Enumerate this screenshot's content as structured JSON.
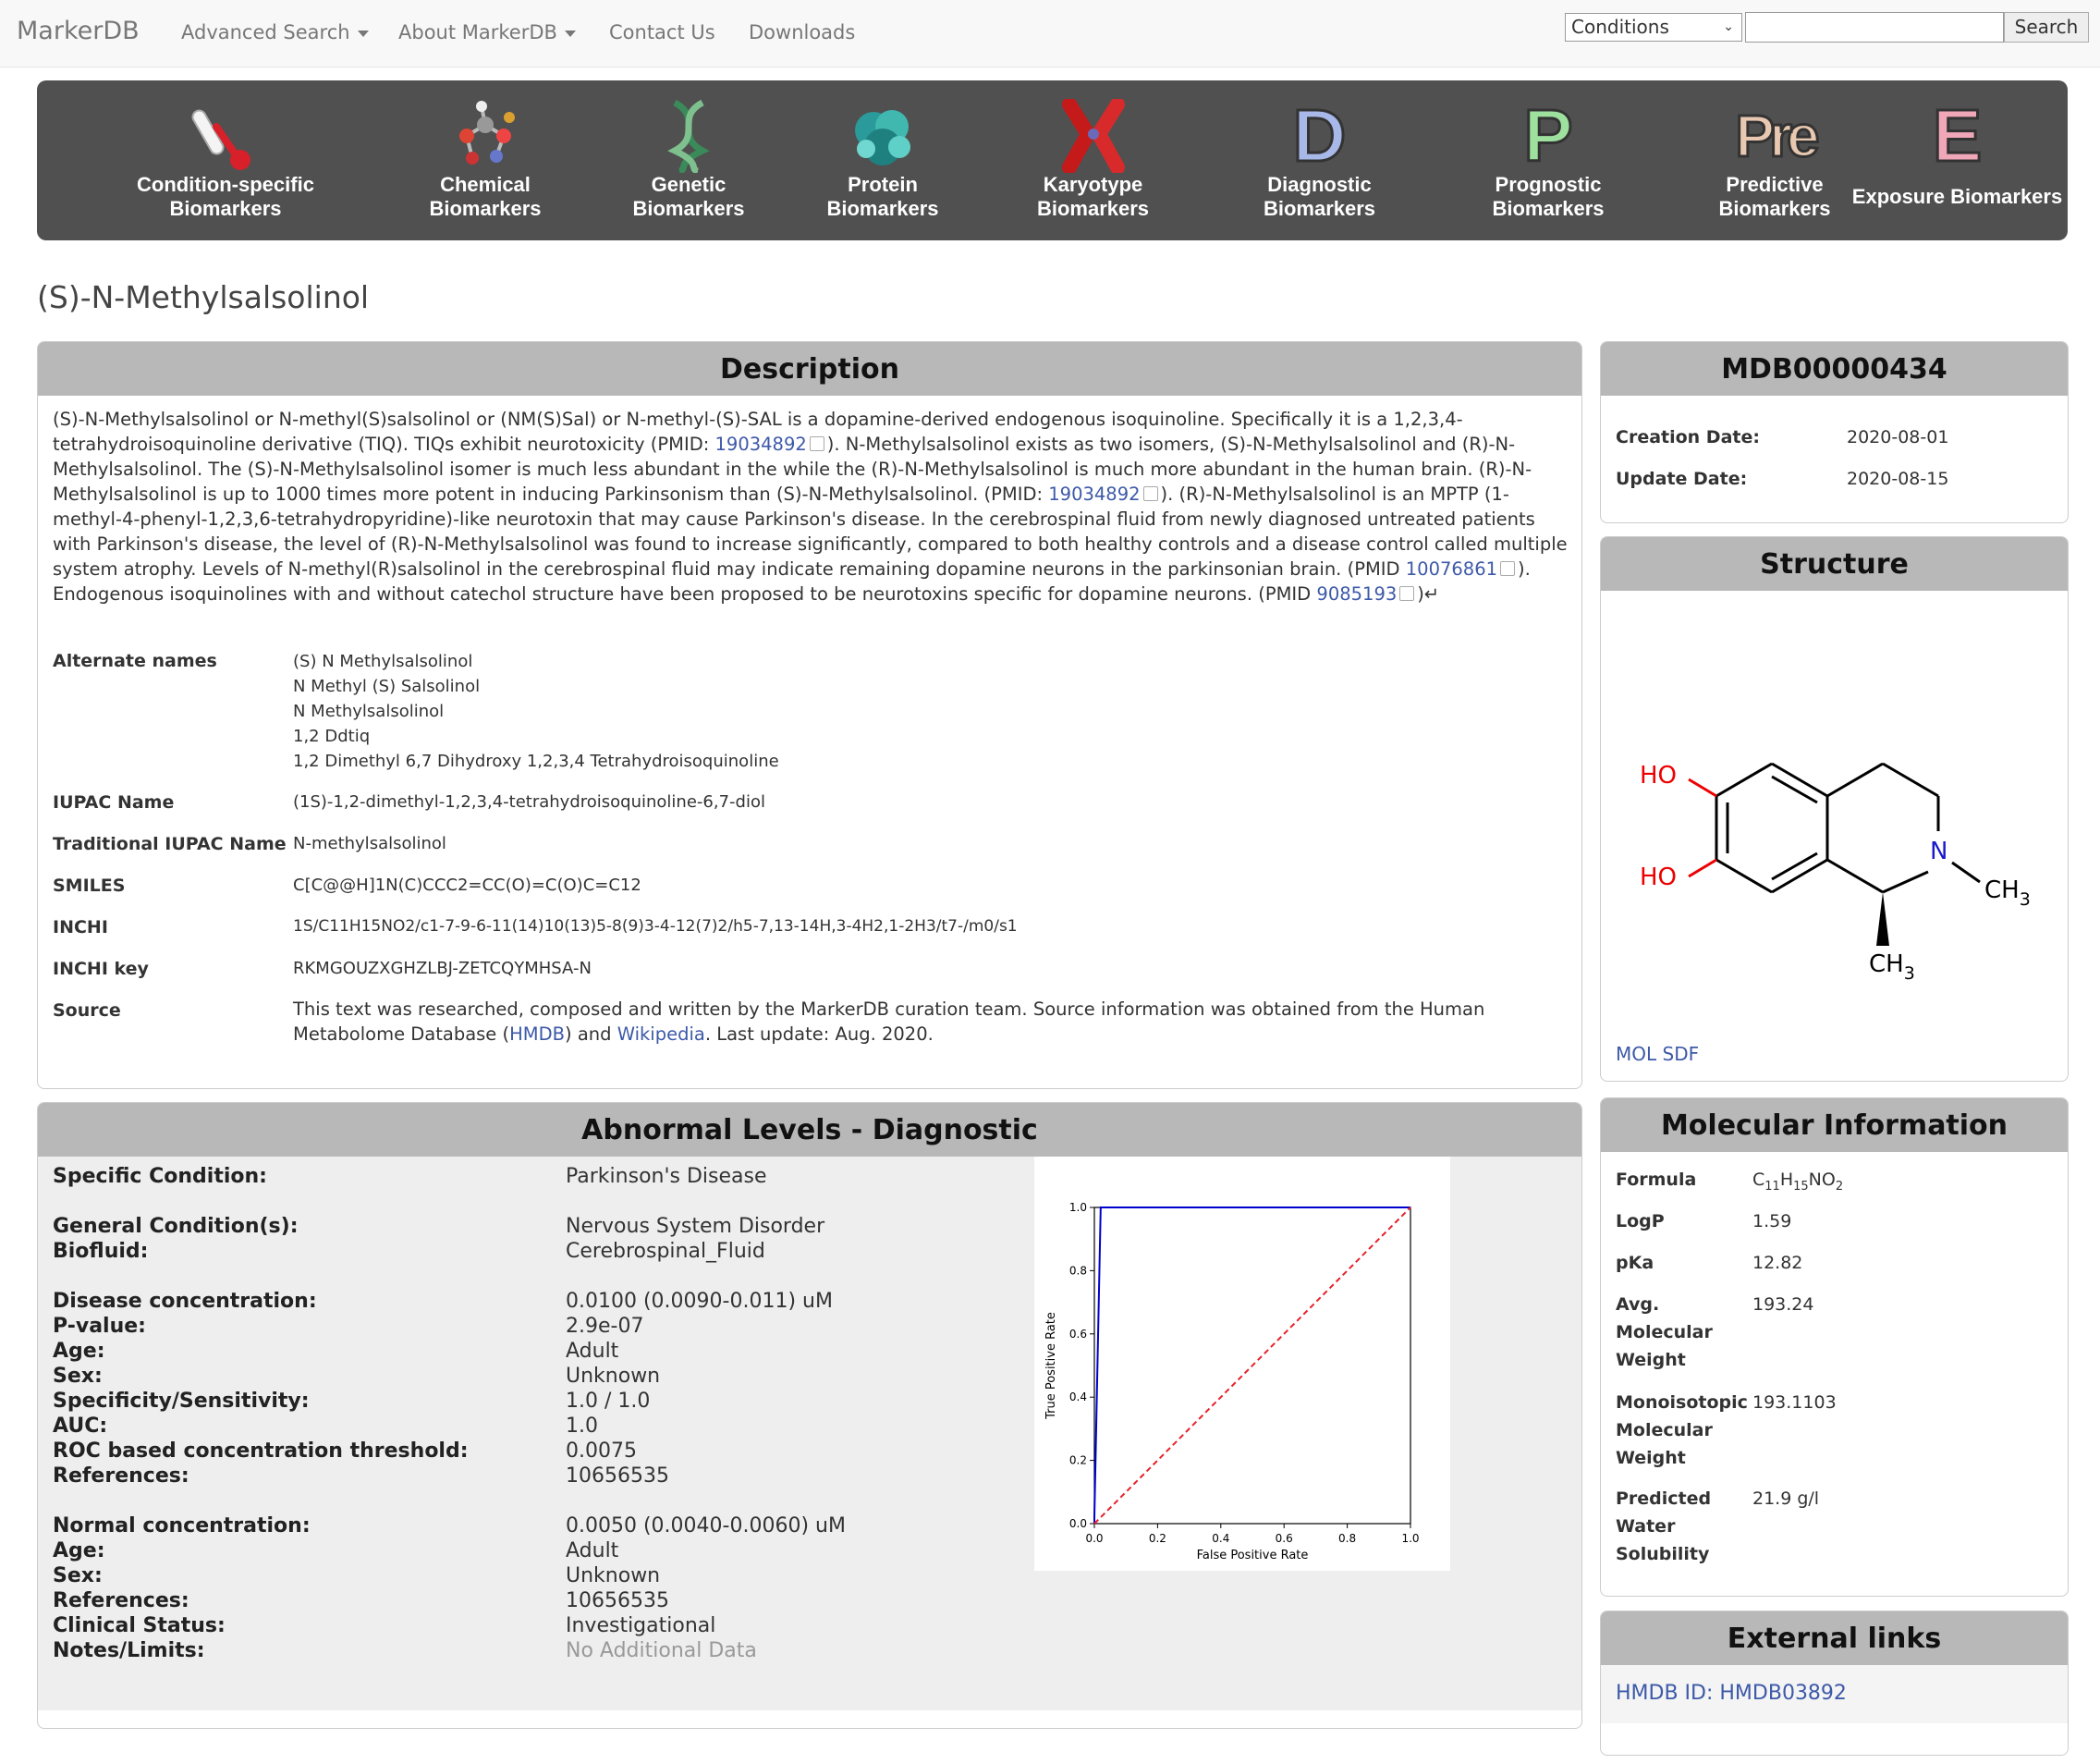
{
  "navbar": {
    "brand": "MarkerDB",
    "items": [
      "Advanced Search",
      "About MarkerDB",
      "Contact Us",
      "Downloads"
    ],
    "select_value": "Conditions",
    "search_button": "Search"
  },
  "categories": [
    {
      "line1": "Condition-specific",
      "line2": "Biomarkers",
      "icon": "thermometer-icon"
    },
    {
      "line1": "Chemical",
      "line2": "Biomarkers",
      "icon": "molecule-icon"
    },
    {
      "line1": "Genetic",
      "line2": "Biomarkers",
      "icon": "dna-icon"
    },
    {
      "line1": "Protein",
      "line2": "Biomarkers",
      "icon": "protein-icon"
    },
    {
      "line1": "Karyotype",
      "line2": "Biomarkers",
      "icon": "chromosome-icon"
    },
    {
      "line1": "Diagnostic",
      "line2": "Biomarkers",
      "icon": "letter-d-icon",
      "letter": "D"
    },
    {
      "line1": "Prognostic",
      "line2": "Biomarkers",
      "icon": "letter-p-icon",
      "letter": "P"
    },
    {
      "line1": "Predictive",
      "line2": "Biomarkers",
      "icon": "letter-pre-icon",
      "letter": "Pre"
    },
    {
      "line1": "Exposure Biomarkers",
      "line2": "",
      "icon": "letter-e-icon",
      "letter": "E"
    }
  ],
  "page_title": "(S)-N-Methylsalsolinol",
  "description": {
    "heading": "Description",
    "p1": "(S)-N-Methylsalsolinol or N-methyl(S)salsolinol or (NM(S)Sal) or N-methyl-(S)-SAL is a dopamine-derived endogenous isoquinoline. Specifically it is a 1,2,3,4-tetrahydroisoquinoline derivative (TIQ). TIQs exhibit neurotoxicity (PMID: ",
    "pmid1": "19034892",
    "p2": "). N-Methylsalsolinol exists as two isomers, (S)-N-Methylsalsolinol and (R)-N-Methylsalsolinol. The (S)-N-Methylsalsolinol isomer is much less abundant in the while the (R)-N-Methylsalsolinol is much more abundant in the human brain. (R)-N-Methylsalsolinol is up to 1000 times more potent in inducing Parkinsonism than (S)-N-Methylsalsolinol. (PMID: ",
    "pmid2": "19034892",
    "p3": "). (R)-N-Methylsalsolinol is an MPTP (1-methyl-4-phenyl-1,2,3,6-tetrahydropyridine)-like neurotoxin that may cause Parkinson's disease. In the cerebrospinal fluid from newly diagnosed untreated patients with Parkinson's disease, the level of (R)-N-Methylsalsolinol was found to increase significantly, compared to both healthy controls and a disease control called multiple system atrophy. Levels of N-methyl(R)salsolinol in the cerebrospinal fluid may indicate remaining dopamine neurons in the parkinsonian brain. (PMID ",
    "pmid3": "10076861",
    "p4": "). Endogenous isoquinolines with and without catechol structure have been proposed to be neurotoxins specific for dopamine neurons. (PMID ",
    "pmid4": "9085193",
    "p5": ")↵",
    "alt_label": "Alternate names",
    "alt_names": [
      "(S) N Methylsalsolinol",
      "N Methyl (S) Salsolinol",
      "N Methylsalsolinol",
      "1,2 Ddtiq",
      "1,2 Dimethyl 6,7 Dihydroxy 1,2,3,4 Tetrahydroisoquinoline"
    ],
    "iupac_label": "IUPAC Name",
    "iupac": "(1S)-1,2-dimethyl-1,2,3,4-tetrahydroisoquinoline-6,7-diol",
    "trad_label": "Traditional IUPAC Name",
    "trad": "N-methylsalsolinol",
    "smiles_label": "SMILES",
    "smiles": "C[C@@H]1N(C)CCC2=CC(O)=C(O)C=C12",
    "inchi_label": "INCHI",
    "inchi": "1S/C11H15NO2/c1-7-9-6-11(14)10(13)5-8(9)3-4-12(7)2/h5-7,13-14H,3-4H2,1-2H3/t7-/m0/s1",
    "inchikey_label": "INCHI key",
    "inchikey": "RKMGOUZXGHZLBJ-ZETCQYMHSA-N",
    "source_label": "Source",
    "source_a": "This text was researched, composed and written by the MarkerDB curation team. Source information was obtained from the Human Metabolome Database (",
    "source_hmdb": "HMDB",
    "source_b": ") and ",
    "source_wiki": "Wikipedia",
    "source_c": ". Last update: Aug. 2020."
  },
  "meta": {
    "id": "MDB00000434",
    "creation_label": "Creation Date:",
    "creation": "2020-08-01",
    "update_label": "Update Date:",
    "update": "2020-08-15"
  },
  "structure": {
    "heading": "Structure",
    "ho1": "HO",
    "ho2": "HO",
    "n": "N",
    "ch3_a": "CH",
    "ch3_b": "CH",
    "sub3": "3",
    "mol_link": "MOL",
    "sdf_link": "SDF"
  },
  "abnormal": {
    "heading": "Abnormal Levels - Diagnostic",
    "rows": [
      {
        "k": "Specific Condition:",
        "v": "Parkinson's Disease",
        "link": true
      },
      {
        "k": "General Condition(s):",
        "v": "Nervous System Disorder",
        "link": true
      },
      {
        "k": "Biofluid:",
        "v": "Cerebrospinal_Fluid"
      },
      {
        "k": "Disease concentration:",
        "v": "0.0100 (0.0090-0.011) uM"
      },
      {
        "k": "P-value:",
        "v": "2.9e-07"
      },
      {
        "k": "Age:",
        "v": "Adult"
      },
      {
        "k": "Sex:",
        "v": "Unknown"
      },
      {
        "k": "Specificity/Sensitivity:",
        "v": "1.0 / 1.0"
      },
      {
        "k": "AUC:",
        "v": "1.0"
      },
      {
        "k": "ROC based concentration threshold:",
        "v": "0.0075"
      },
      {
        "k": "References:",
        "v": "10656535",
        "link": true
      },
      {
        "k": "Normal concentration:",
        "v": "0.0050 (0.0040-0.0060) uM"
      },
      {
        "k": "Age:",
        "v": "Adult"
      },
      {
        "k": "Sex:",
        "v": "Unknown"
      },
      {
        "k": "References:",
        "v": "10656535",
        "link": true
      },
      {
        "k": "Clinical Status:",
        "v": "Investigational"
      },
      {
        "k": "Notes/Limits:",
        "v": "No Additional Data",
        "muted": true
      }
    ]
  },
  "chart_data": {
    "type": "line",
    "title": "",
    "xlabel": "False Positive Rate",
    "ylabel": "True Positive Rate",
    "xlim": [
      0,
      1
    ],
    "ylim": [
      0,
      1
    ],
    "xticks": [
      "0.0",
      "0.2",
      "0.4",
      "0.6",
      "0.8",
      "1.0"
    ],
    "yticks": [
      "0.0",
      "0.2",
      "0.4",
      "0.6",
      "0.8",
      "1.0"
    ],
    "series": [
      {
        "x": [
          0.0,
          0.0,
          0.02,
          1.0
        ],
        "y": [
          0.0,
          0.02,
          1.0,
          1.0
        ],
        "color": "#0000cc",
        "style": "solid"
      },
      {
        "x": [
          0.0,
          1.0
        ],
        "y": [
          0.0,
          1.0
        ],
        "color": "#e8202a",
        "style": "dashed"
      }
    ]
  },
  "molecular": {
    "heading": "Molecular Information",
    "formula_label": "Formula",
    "formula": {
      "c": "C",
      "c_n": "11",
      "h": "H",
      "h_n": "15",
      "rest": "NO",
      "o_n": "2"
    },
    "logp_label": "LogP",
    "logp": "1.59",
    "pka_label": "pKa",
    "pka": "12.82",
    "avg_label": [
      "Avg.",
      "Molecular",
      "Weight"
    ],
    "avg": "193.24",
    "mono_label": [
      "Monoisotopic",
      "Molecular",
      "Weight"
    ],
    "mono": "193.1103",
    "sol_label": [
      "Predicted",
      "Water",
      "Solubility"
    ],
    "sol": "21.9 g/l"
  },
  "external": {
    "heading": "External links",
    "hmdb": "HMDB ID: HMDB03892"
  }
}
